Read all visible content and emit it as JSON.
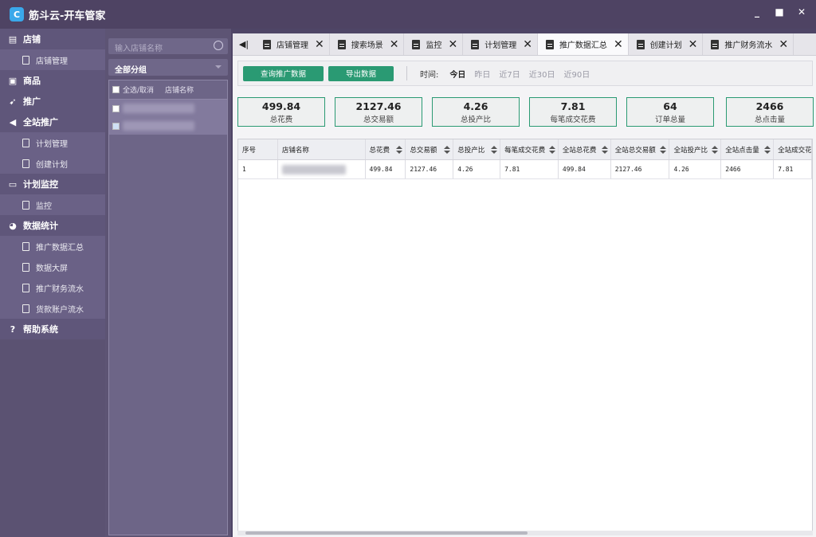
{
  "app": {
    "title": "筋斗云-开车管家",
    "logo_glyph": "C",
    "controls": [
      "_",
      "■",
      "✕"
    ]
  },
  "sidebar": {
    "sections": [
      {
        "label": "店铺",
        "icon": "store-icon",
        "items": [
          "店铺管理"
        ]
      },
      {
        "label": "商品",
        "icon": "bag-icon",
        "items": []
      },
      {
        "label": "推广",
        "icon": "rocket-icon",
        "items": []
      },
      {
        "label": "全站推广",
        "icon": "megaphone-icon",
        "items": [
          "计划管理",
          "创建计划"
        ]
      },
      {
        "label": "计划监控",
        "icon": "monitor-icon",
        "items": [
          "监控"
        ]
      },
      {
        "label": "数据统计",
        "icon": "pie-chart-icon",
        "items": [
          "推广数据汇总",
          "数据大屏",
          "推广财务流水",
          "货款账户流水"
        ]
      },
      {
        "label": "帮助系统",
        "icon": "help-icon",
        "items": []
      }
    ]
  },
  "shop_panel": {
    "search_placeholder": "输入店铺名称",
    "group_select": "全部分组",
    "select_all": "全选/取消",
    "col_name": "店铺名称"
  },
  "tabs": [
    {
      "label": "店铺管理",
      "active": false
    },
    {
      "label": "搜索场景",
      "active": false
    },
    {
      "label": "监控",
      "active": false
    },
    {
      "label": "计划管理",
      "active": false
    },
    {
      "label": "推广数据汇总",
      "active": true
    },
    {
      "label": "创建计划",
      "active": false
    },
    {
      "label": "推广财务流水",
      "active": false
    }
  ],
  "toolbar": {
    "query_btn": "查询推广数据",
    "export_btn": "导出数据",
    "time_label": "时间:",
    "time_options": [
      "今日",
      "昨日",
      "近7日",
      "近30日",
      "近90日"
    ],
    "selected_time": "今日"
  },
  "stats": [
    {
      "value": "499.84",
      "label": "总花费"
    },
    {
      "value": "2127.46",
      "label": "总交易额"
    },
    {
      "value": "4.26",
      "label": "总投产比"
    },
    {
      "value": "7.81",
      "label": "每笔成交花费"
    },
    {
      "value": "64",
      "label": "订单总量"
    },
    {
      "value": "2466",
      "label": "总点击量"
    }
  ],
  "table": {
    "columns": [
      "序号",
      "店铺名称",
      "总花费",
      "总交易额",
      "总投产比",
      "每笔成交花费",
      "全站总花费",
      "全站总交易额",
      "全站投产比",
      "全站点击量",
      "全站成交花"
    ],
    "rows": [
      [
        "1",
        "",
        "499.84",
        "2127.46",
        "4.26",
        "7.81",
        "499.84",
        "2127.46",
        "4.26",
        "2466",
        "7.81"
      ]
    ]
  },
  "colors": {
    "accent": "#2a9a73",
    "sidebar": "#5b5272",
    "titlebar": "#4e4363"
  }
}
